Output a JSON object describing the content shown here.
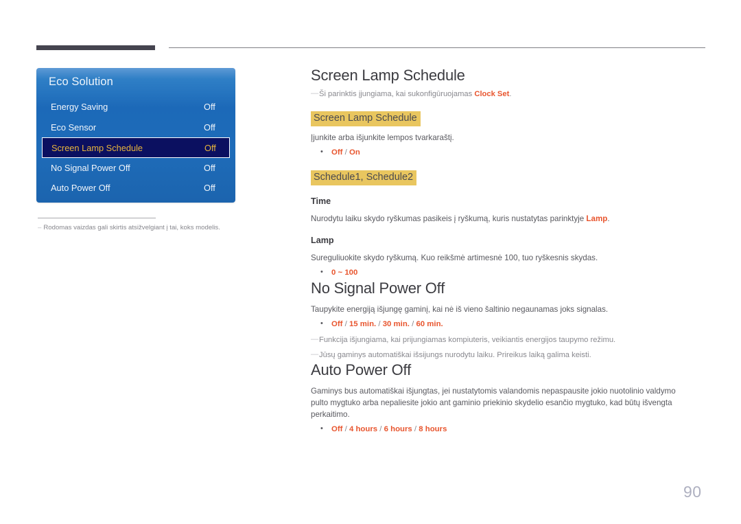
{
  "page": {
    "number": "90"
  },
  "osd": {
    "title": "Eco Solution",
    "rows": [
      {
        "label": "Energy Saving",
        "value": "Off",
        "selected": false
      },
      {
        "label": "Eco Sensor",
        "value": "Off",
        "selected": false
      },
      {
        "label": "Screen Lamp Schedule",
        "value": "Off",
        "selected": true
      },
      {
        "label": "No Signal Power Off",
        "value": "Off",
        "selected": false
      },
      {
        "label": "Auto Power Off",
        "value": "Off",
        "selected": false
      }
    ],
    "footnote": {
      "dash": "–",
      "text": "Rodomas vaizdas gali skirtis atsižvelgiant į tai, koks modelis."
    }
  },
  "content": {
    "section1": {
      "heading": "Screen Lamp Schedule",
      "note_dash": "—",
      "note_pre": "Ši parinktis įjungiama, kai sukonfigūruojamas ",
      "note_hot": "Clock Set",
      "note_post": ".",
      "sub1_highlight": "Screen Lamp Schedule",
      "sub1_body": "Įjunkite arba išjunkite lempos tvarkaraštį.",
      "sub1_opt_a": "Off",
      "sub1_opt_sep": " / ",
      "sub1_opt_b": "On",
      "sub2_highlight": "Schedule1, Schedule2",
      "time_title": "Time",
      "time_body_pre": "Nurodytu laiku skydo ryškumas pasikeis į ryškumą, kuris nustatytas parinktyje ",
      "time_body_hot": "Lamp",
      "time_body_post": ".",
      "lamp_title": "Lamp",
      "lamp_body": "Sureguliuokite skydo ryškumą. Kuo reikšmė artimesnė 100, tuo ryškesnis skydas.",
      "lamp_opt": "0 ~ 100"
    },
    "section2": {
      "heading": "No Signal Power Off",
      "body": "Taupykite energiją išjungę gaminį, kai nė iš vieno šaltinio negaunamas joks signalas.",
      "opt_a": "Off",
      "opt_b": "15 min.",
      "opt_c": "30 min.",
      "opt_d": "60 min.",
      "opt_sep": " / ",
      "note_dash": "—",
      "note1": "Funkcija išjungiama, kai prijungiamas kompiuteris, veikiantis energijos taupymo režimu.",
      "note2": "Jūsų gaminys automatiškai išsijungs nurodytu laiku. Prireikus laiką galima keisti."
    },
    "section3": {
      "heading": "Auto Power Off",
      "body": "Gaminys bus automatiškai išjungtas, jei nustatytomis valandomis nepaspausite jokio nuotolinio valdymo pulto mygtuko arba nepaliesite jokio ant gaminio priekinio skydelio esančio mygtuko, kad būtų išvengta perkaitimo.",
      "opt_a": "Off",
      "opt_b": "4 hours",
      "opt_c": "6 hours",
      "opt_d": "8 hours",
      "opt_sep": " / "
    }
  }
}
